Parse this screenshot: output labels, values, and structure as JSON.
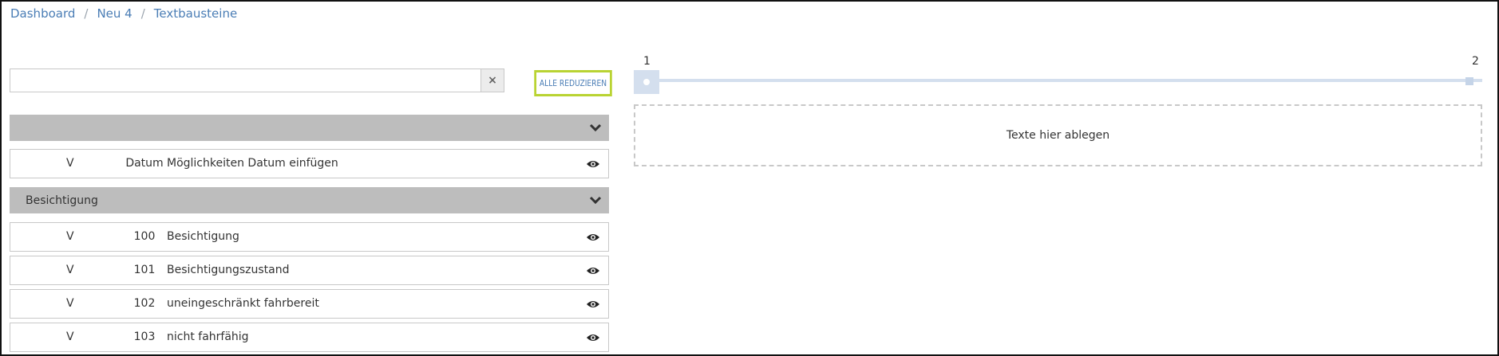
{
  "breadcrumb": [
    "Dashboard",
    "Neu 4",
    "Textbausteine"
  ],
  "breadcrumb_separator": "/",
  "search": {
    "value": "",
    "placeholder": "",
    "clear_label": "×"
  },
  "collapse_all_label": "ALLE REDUZIEREN",
  "slider": {
    "min_label": "1",
    "max_label": "2",
    "value": 1
  },
  "dropzone_label": "Texte hier ablegen",
  "groups": [
    {
      "title": "",
      "expanded": true,
      "items": [
        {
          "type": "V",
          "code": "Datum",
          "text": "Möglichkeiten Datum einfügen"
        }
      ]
    },
    {
      "title": "Besichtigung",
      "expanded": true,
      "items": [
        {
          "type": "V",
          "code": "100",
          "text": "Besichtigung"
        },
        {
          "type": "V",
          "code": "101",
          "text": "Besichtigungszustand"
        },
        {
          "type": "V",
          "code": "102",
          "text": "uneingeschränkt fahrbereit"
        },
        {
          "type": "V",
          "code": "103",
          "text": "nicht fahrfähig"
        }
      ]
    }
  ],
  "colors": {
    "link": "#4a7db5",
    "highlight_border": "#b9d332",
    "group_bg": "#bdbdbd",
    "slider": "#d4dfee"
  },
  "icons": {
    "group_toggle": "chevron-down-icon",
    "preview": "eye-icon",
    "clear": "close-icon"
  }
}
